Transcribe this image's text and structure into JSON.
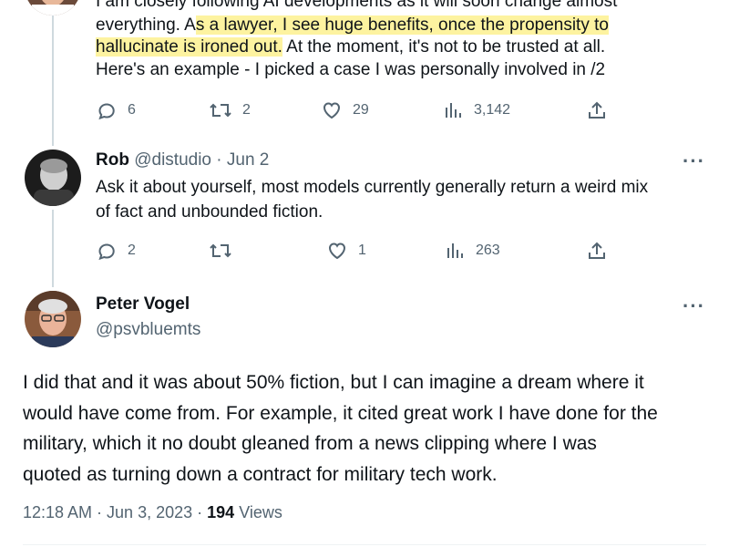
{
  "tweet1": {
    "line0": "I am closely following AI developments as it will soon change almost",
    "line1_pre": "everything. A",
    "line1_hl": "s a lawyer, I see huge benefits, once the propensity to",
    "line2_hl": "hallucinate is ironed out.",
    "line2_post": " At the moment, it's not to be trusted at all.",
    "line3": "Here's an example - I picked a case I was personally involved in /2",
    "replies": "6",
    "retweets": "2",
    "likes": "29",
    "views": "3,142"
  },
  "tweet2": {
    "name": "Rob",
    "handle": "@distudio",
    "date": "· Jun 2",
    "line1": "Ask it about yourself, most models currently generally return a weird mix",
    "line2": "of fact and unbounded fiction.",
    "replies": "2",
    "likes": "1",
    "views": "263"
  },
  "main": {
    "name": "Peter Vogel",
    "handle": "@psvbluemts",
    "line1": "I did that and it was about 50% fiction, but I can imagine a dream where it",
    "line2": "would have come from. For example, it cited great work I have done for the",
    "line3": "military, which it no doubt gleaned from a news clipping where I was",
    "line4": "quoted as turning down a contract for military tech work.",
    "time": "12:18 AM · Jun 3, 2023 ·",
    "views_count": "194",
    "views_label": "Views"
  },
  "more_glyph": "···",
  "colors": {
    "text": "#0f1419",
    "muted": "#536471",
    "highlight": "#fdf3a0",
    "thread": "#cfd9de"
  },
  "icons": [
    "reply-icon",
    "retweet-icon",
    "like-icon",
    "views-icon",
    "share-icon",
    "more-icon"
  ]
}
